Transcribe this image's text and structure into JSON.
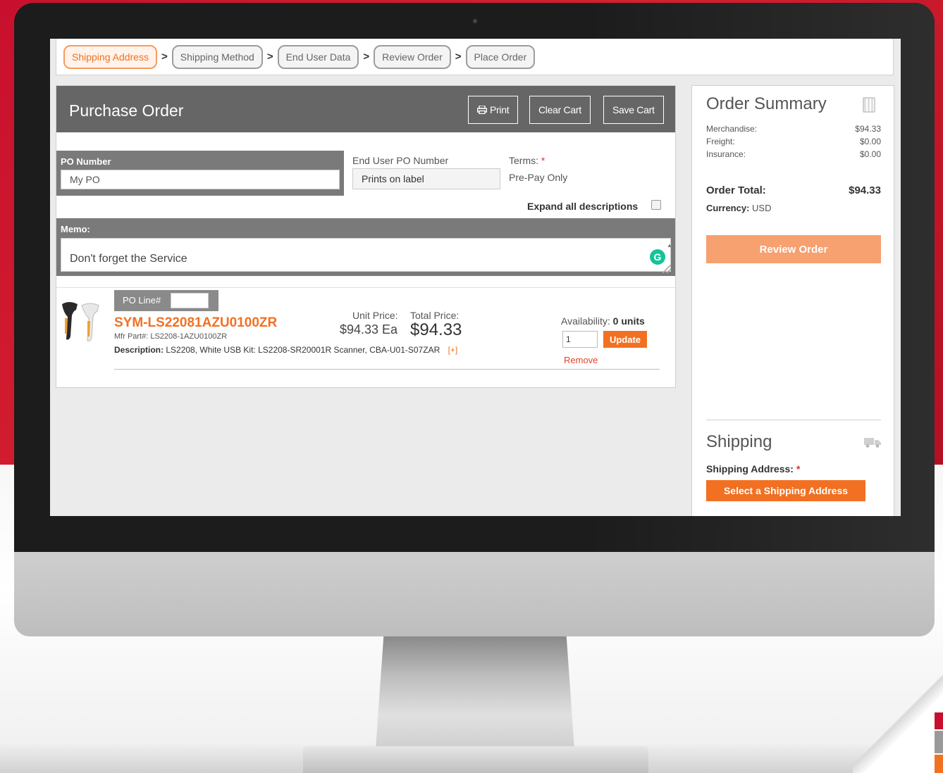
{
  "steps": [
    {
      "label": "Shipping Address",
      "active": true
    },
    {
      "label": "Shipping Method",
      "active": false
    },
    {
      "label": "End User Data",
      "active": false
    },
    {
      "label": "Review Order",
      "active": false
    },
    {
      "label": "Place Order",
      "active": false
    }
  ],
  "step_separator": ">",
  "purchase_order": {
    "title": "Purchase Order",
    "print_label": "Print",
    "clear_cart_label": "Clear Cart",
    "save_cart_label": "Save Cart",
    "po_number_label": "PO Number",
    "po_number_value": "My PO",
    "end_user_po_label": "End User PO Number",
    "end_user_po_value": "Prints on label",
    "terms_label": "Terms:",
    "required_marker": "*",
    "terms_value": "Pre-Pay Only",
    "expand_all_label": "Expand all descriptions",
    "memo_label": "Memo:",
    "memo_value": "Don't forget the Service"
  },
  "line_item": {
    "po_line_label": "PO Line#",
    "po_line_value": "",
    "sku": "SYM-LS22081AZU0100ZR",
    "mfr_part": "Mfr Part#: LS2208-1AZU0100ZR",
    "description_label": "Description:",
    "description": "LS2208, White USB Kit: LS2208-SR20001R Scanner, CBA-U01-S07ZAR",
    "expand_label": "[+]",
    "unit_price_label": "Unit Price:",
    "total_price_label": "Total Price:",
    "unit_price": "$94.33 Ea",
    "total_price": "$94.33",
    "availability_label": "Availability:",
    "availability_value": "0 units",
    "quantity": "1",
    "update_label": "Update",
    "remove_label": "Remove"
  },
  "order_summary": {
    "title": "Order Summary",
    "rows": [
      {
        "label": "Merchandise:",
        "value": "$94.33"
      },
      {
        "label": "Freight:",
        "value": "$0.00"
      },
      {
        "label": "Insurance:",
        "value": "$0.00"
      }
    ],
    "order_total_label": "Order Total:",
    "order_total_value": "$94.33",
    "currency_label": "Currency:",
    "currency_value": "USD",
    "review_order_label": "Review Order"
  },
  "shipping": {
    "title": "Shipping",
    "address_label": "Shipping Address:",
    "required_marker": "*",
    "select_address_label": "Select a Shipping Address"
  },
  "colors": {
    "accent_orange": "#f27022",
    "brand_red": "#c8102e",
    "header_grey": "#666666",
    "grammarly_green": "#15c39a"
  },
  "icons": [
    "printer-icon",
    "calculator-icon",
    "truck-icon",
    "grammarly-icon",
    "checkbox-icon",
    "scanner-product-image"
  ]
}
